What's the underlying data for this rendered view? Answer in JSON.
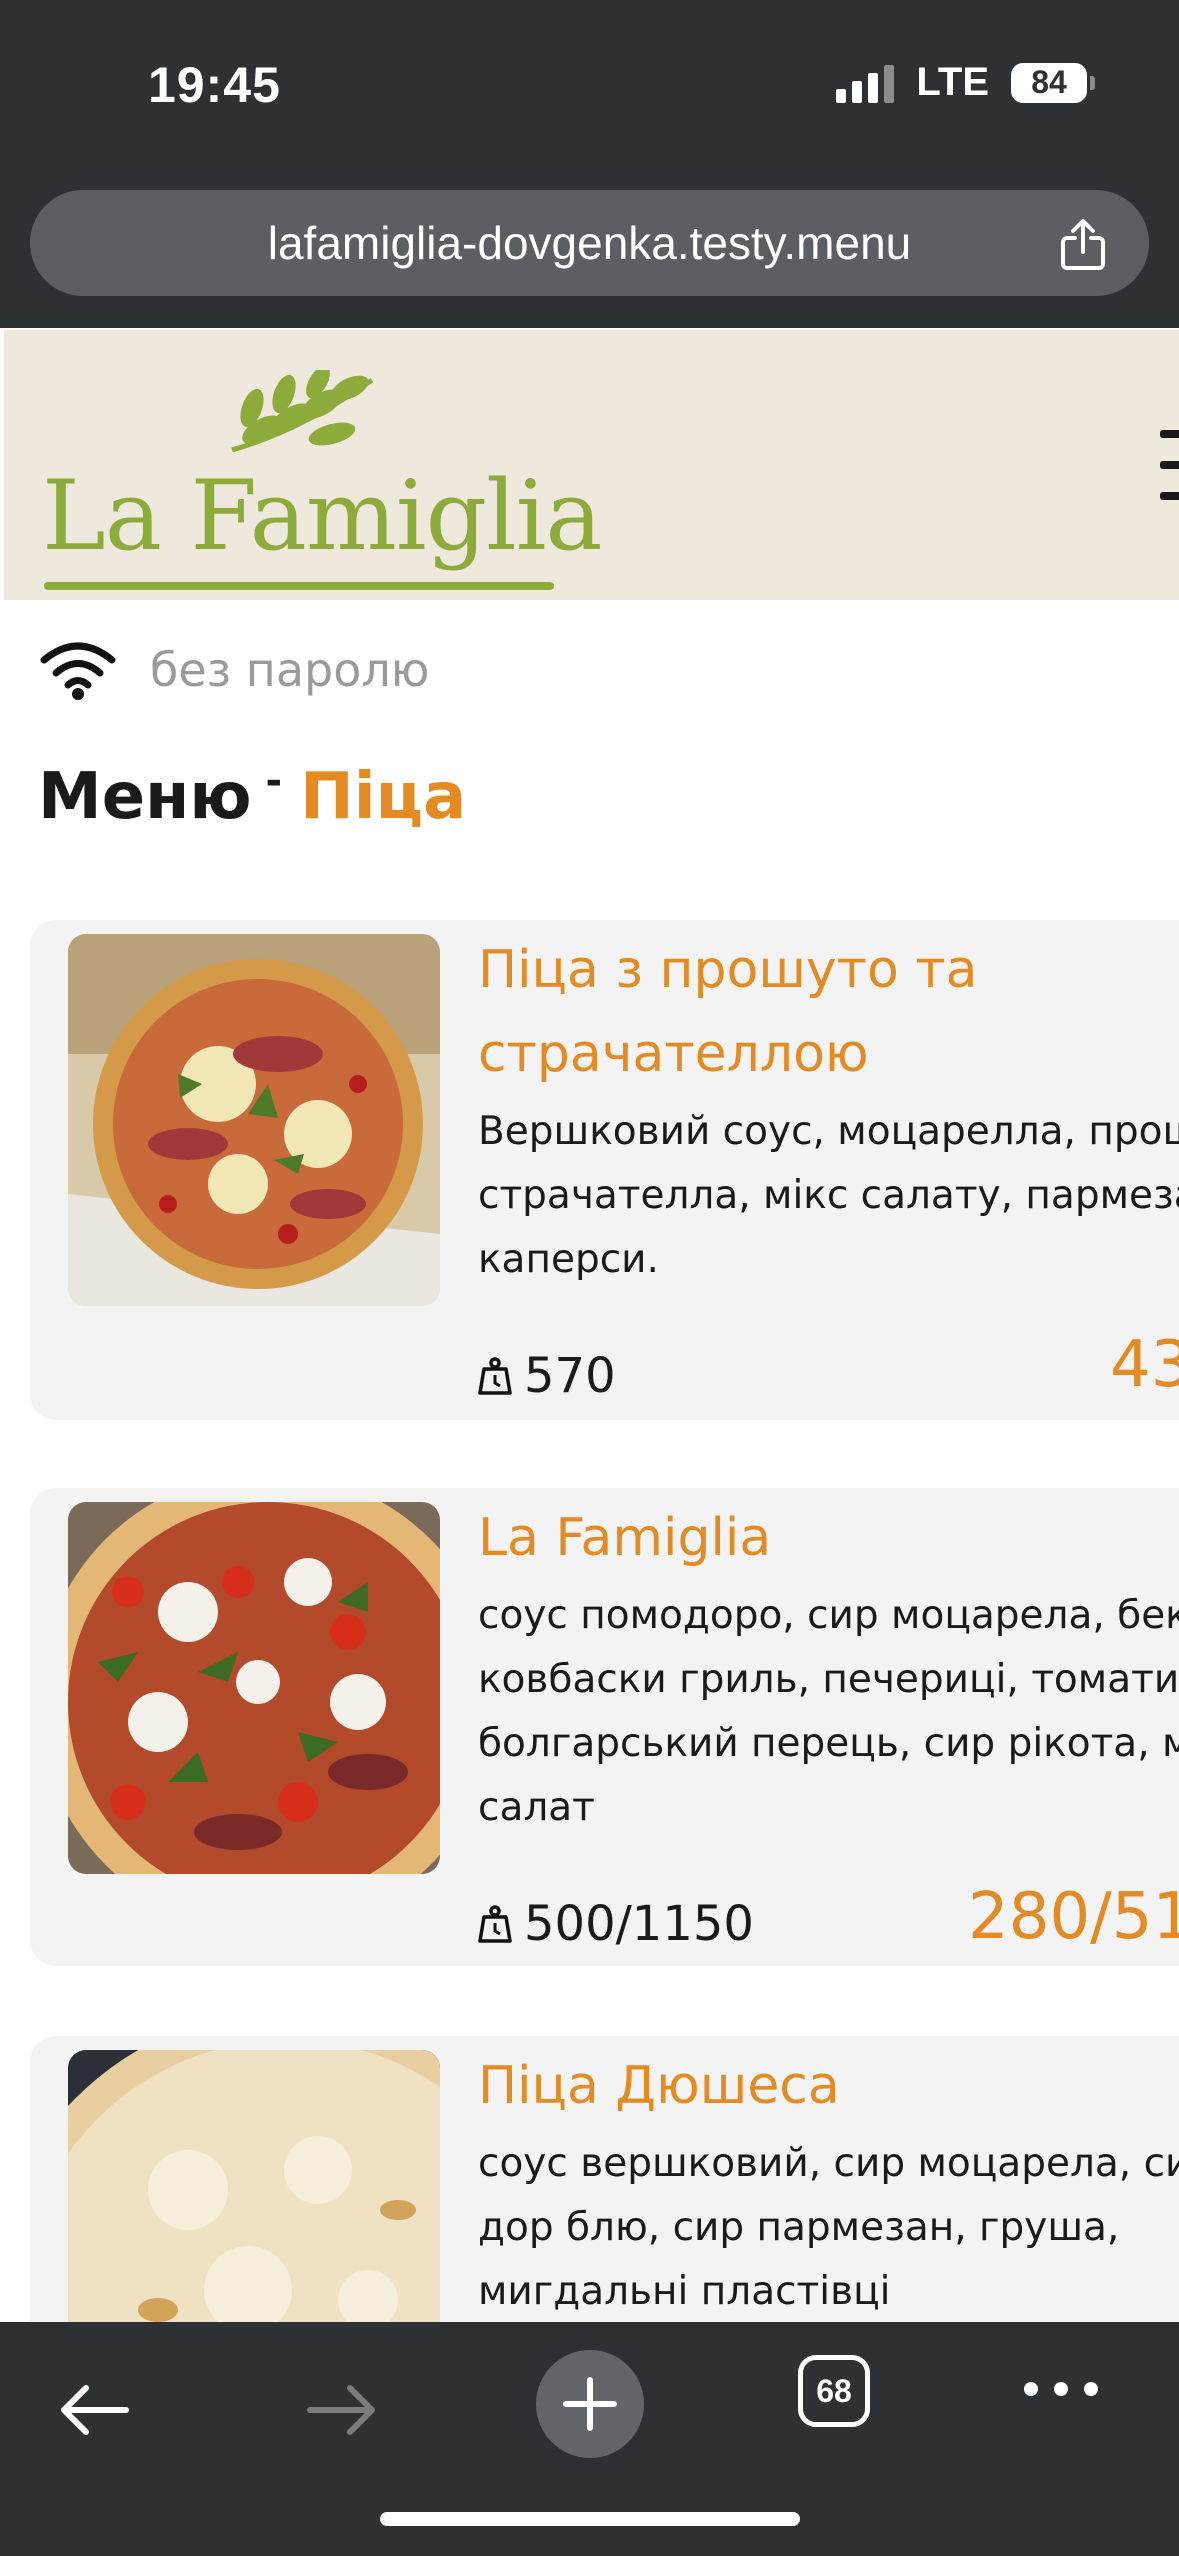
{
  "status_bar": {
    "time": "19:45",
    "network": "LTE",
    "battery": "84"
  },
  "browser": {
    "url": "lafamiglia-dovgenka.testy.menu",
    "tabs_count": "68",
    "share_icon": "share-icon",
    "back_icon": "arrow-left-icon",
    "forward_icon": "arrow-right-icon",
    "new_tab_icon": "plus-icon",
    "more_icon": "ellipsis-icon"
  },
  "site": {
    "logo_text": "La Famiglia",
    "brand_color": "#8cab3a",
    "accent_color": "#e38a23",
    "menu_icon": "hamburger-icon"
  },
  "wifi": {
    "icon": "wifi-icon",
    "text": "без паролю"
  },
  "heading": {
    "title": "Меню",
    "separator": "-",
    "category": "Піца"
  },
  "products": [
    {
      "title_lines": [
        "Піца з прошуто та",
        "страчателлою"
      ],
      "desc_lines": [
        "Вершковий соус, моцарелла, прош",
        "страчателла, мікс салату, пармеза",
        "каперси."
      ],
      "weight": "570",
      "price": "43"
    },
    {
      "title_lines": [
        "La Famiglia"
      ],
      "desc_lines": [
        "соус помодоро, сир моцарела, бек",
        "ковбаски гриль, печериці, томати",
        "болгарський перець, сир рікота, м",
        "салат"
      ],
      "weight": "500/1150",
      "price": "280/51"
    },
    {
      "title_lines": [
        "Піца Дюшеса"
      ],
      "desc_lines": [
        "соус вершковий, сир моцарела, си",
        "дор блю, сир пармезан, груша,",
        "мигдальні пластівці"
      ],
      "weight": "",
      "price": ""
    }
  ]
}
